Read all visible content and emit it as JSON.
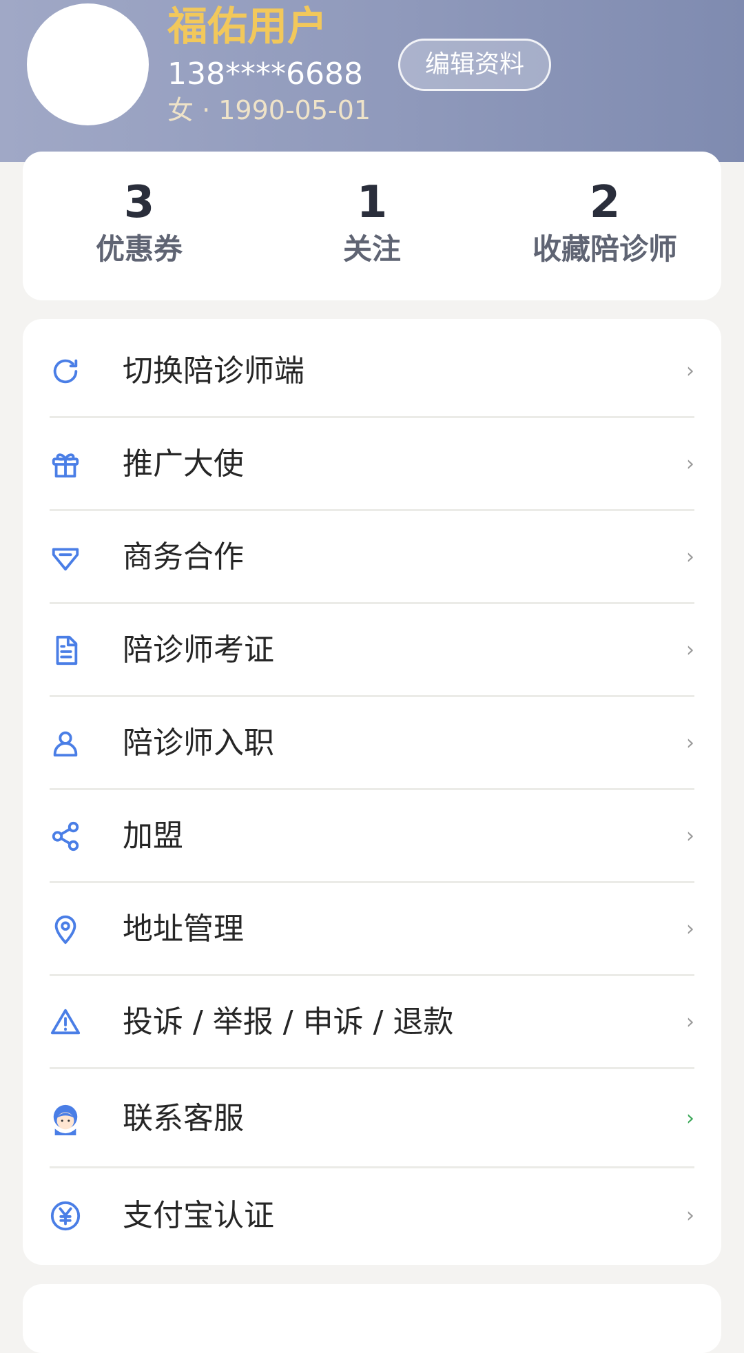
{
  "profile": {
    "name": "福佑用户",
    "phone": "138****6688",
    "info": "女 · 1990-05-01",
    "edit_label": "编辑资料"
  },
  "stats": [
    {
      "value": "3",
      "label": "优惠券"
    },
    {
      "value": "1",
      "label": "关注"
    },
    {
      "value": "2",
      "label": "收藏陪诊师"
    }
  ],
  "menu": {
    "items": [
      {
        "label": "切换陪诊师端",
        "icon": "refresh-icon"
      },
      {
        "label": "推广大使",
        "icon": "gift-icon"
      },
      {
        "label": "商务合作",
        "icon": "diamond-icon"
      },
      {
        "label": "陪诊师考证",
        "icon": "document-icon"
      },
      {
        "label": "陪诊师入职",
        "icon": "user-icon"
      },
      {
        "label": "加盟",
        "icon": "share-icon"
      },
      {
        "label": "地址管理",
        "icon": "location-pin-icon"
      },
      {
        "label": "投诉 / 举报 / 申诉 / 退款",
        "icon": "warning-icon"
      },
      {
        "label": "联系客服",
        "icon": "customer-service-icon"
      },
      {
        "label": "支付宝认证",
        "icon": "yuan-coin-icon"
      }
    ],
    "chevron": "›"
  },
  "colors": {
    "header_gradient_start": "#a0a8c6",
    "header_gradient_end": "#7f8bb0",
    "name_color": "#f2c85b",
    "icon_blue": "#4a7ee6",
    "chevron_green": "#3aa757"
  }
}
